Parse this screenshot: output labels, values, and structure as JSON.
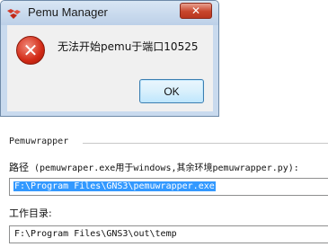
{
  "dialog": {
    "title": "Pemu Manager",
    "close_label": "✕",
    "error_icon_glyph": "✕",
    "message": "无法开始pemu于端口10525",
    "ok_label": "OK"
  },
  "settings": {
    "section_title": "Pemuwrapper",
    "path_label": "路径",
    "path_hint": " (pemuwraper.exe用于windows,其余环境pemuwrapper.py):",
    "path_value": "F:\\Program Files\\GNS3\\pemuwrapper.exe",
    "working_dir_label": "工作目录:",
    "working_dir_value": "F:\\Program Files\\GNS3\\out\\temp"
  },
  "colors": {
    "selection": "#3399ff",
    "close_button": "#c8452c",
    "error_icon": "#d22a16"
  }
}
